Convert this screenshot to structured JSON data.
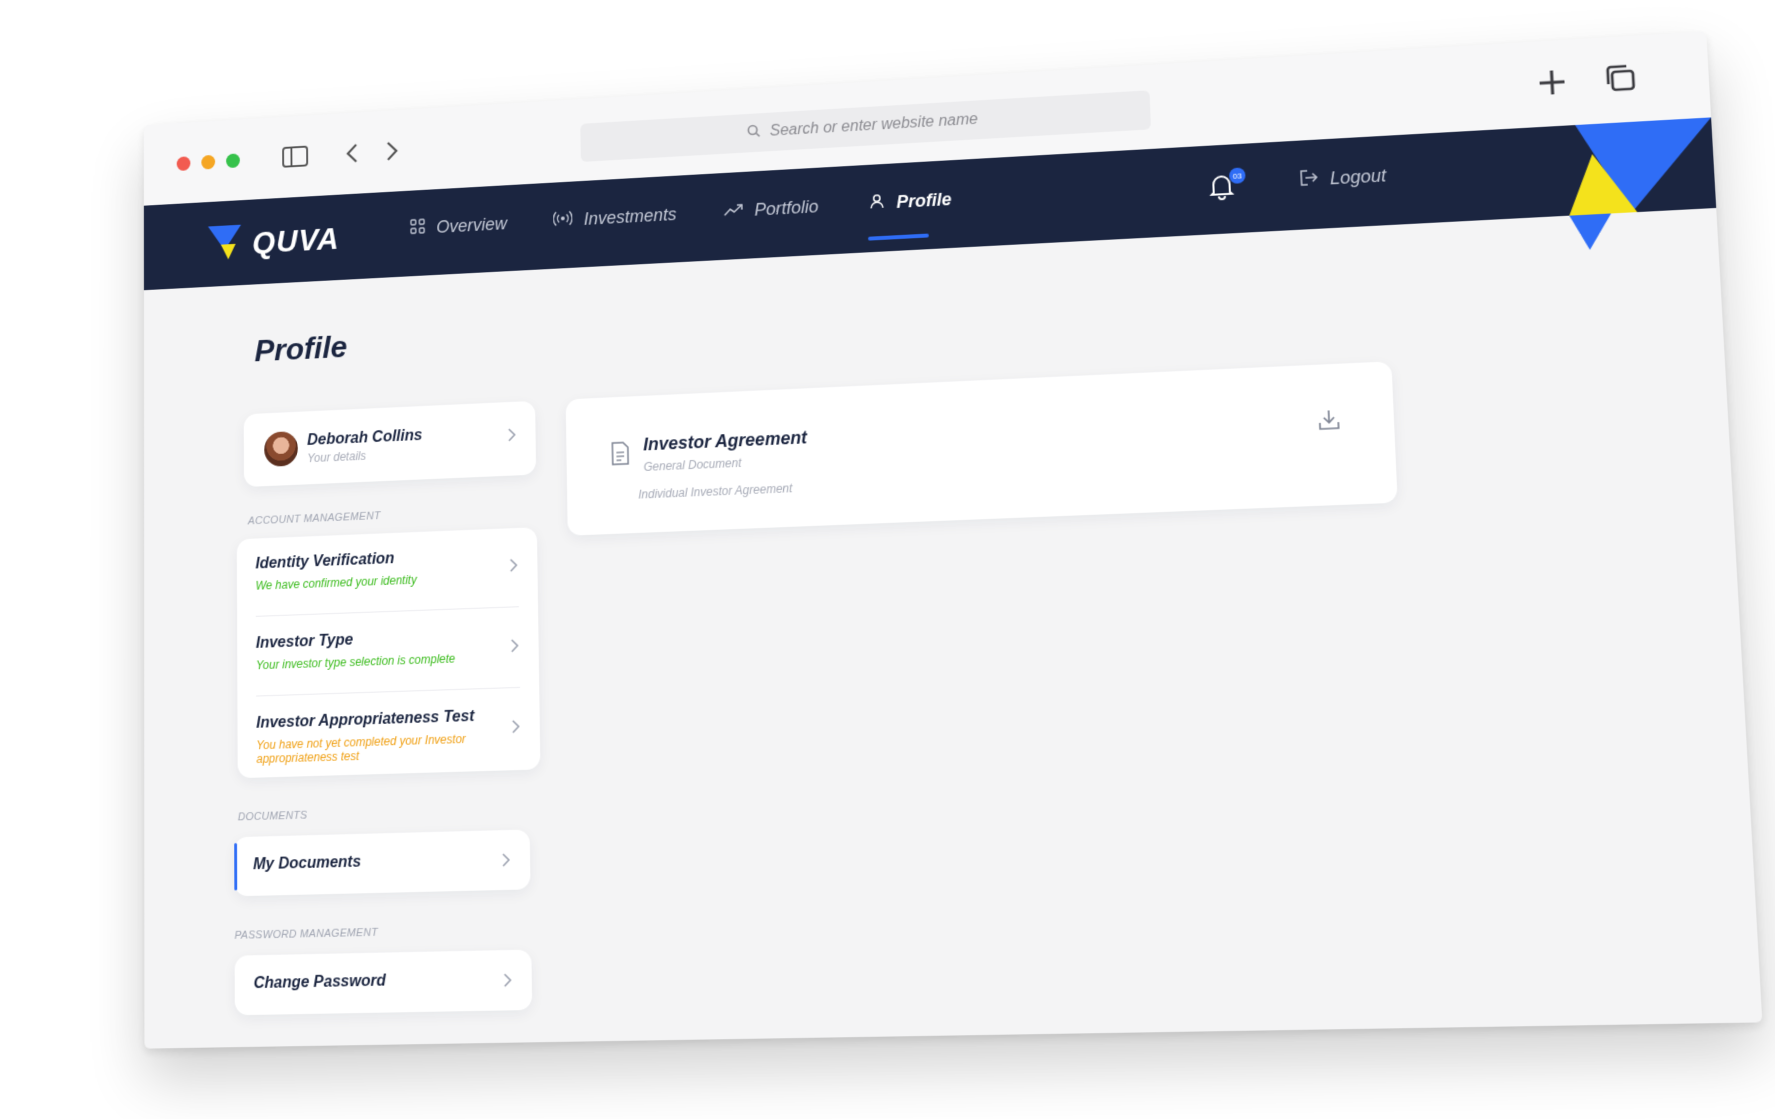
{
  "browser": {
    "url_placeholder": "Search or enter website name"
  },
  "nav": {
    "logo": "QUVA",
    "items": [
      {
        "label": "Overview",
        "icon": "grid-icon"
      },
      {
        "label": "Investments",
        "icon": "broadcast-icon"
      },
      {
        "label": "Portfolio",
        "icon": "trending-up-icon"
      },
      {
        "label": "Profile",
        "icon": "user-icon",
        "active": true
      }
    ],
    "notification_count": "03",
    "logout_label": "Logout"
  },
  "page": {
    "title": "Profile"
  },
  "profile_card": {
    "name": "Deborah Collins",
    "subtitle": "Your details"
  },
  "sections": {
    "account_management": "ACCOUNT MANAGEMENT",
    "documents": "DOCUMENTS",
    "password_management": "PASSWORD MANAGEMENT"
  },
  "account_items": [
    {
      "title": "Identity Verification",
      "status": "We have confirmed your identity",
      "state": "complete"
    },
    {
      "title": "Investor Type",
      "status": "Your investor type selection is complete",
      "state": "complete"
    },
    {
      "title": "Investor Appropriateness Test",
      "status": "You have not yet completed your Investor appropriateness test",
      "state": "pending"
    }
  ],
  "documents_item": {
    "title": "My Documents"
  },
  "password_item": {
    "title": "Change Password"
  },
  "agreement": {
    "title": "Investor Agreement",
    "type": "General Document",
    "description": "Individual Investor Agreement"
  },
  "colors": {
    "nav_bg": "#1b2540",
    "accent": "#2f6df6",
    "success": "#3cbc1e",
    "warning": "#f0a014",
    "brand_yellow": "#f4e21c"
  }
}
